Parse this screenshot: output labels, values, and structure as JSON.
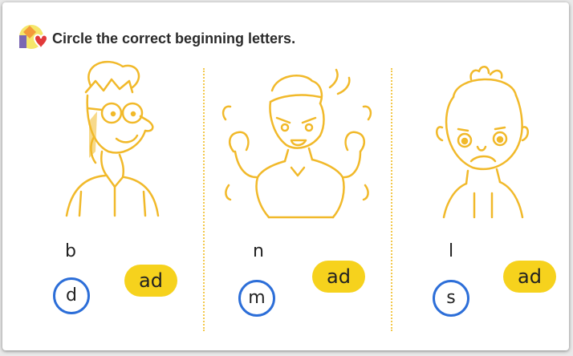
{
  "instruction": "Circle the correct beginning letters.",
  "items": [
    {
      "face": "nerd-face",
      "top_letter": "b",
      "bottom_letter": "d",
      "ending": "ad"
    },
    {
      "face": "angry-face",
      "top_letter": "n",
      "bottom_letter": "m",
      "ending": "ad"
    },
    {
      "face": "sad-face",
      "top_letter": "l",
      "bottom_letter": "s",
      "ending": "ad"
    }
  ],
  "colors": {
    "line_art": "#f1b92a",
    "ad_pill": "#f6d21d",
    "circle": "#2c6ed8"
  }
}
